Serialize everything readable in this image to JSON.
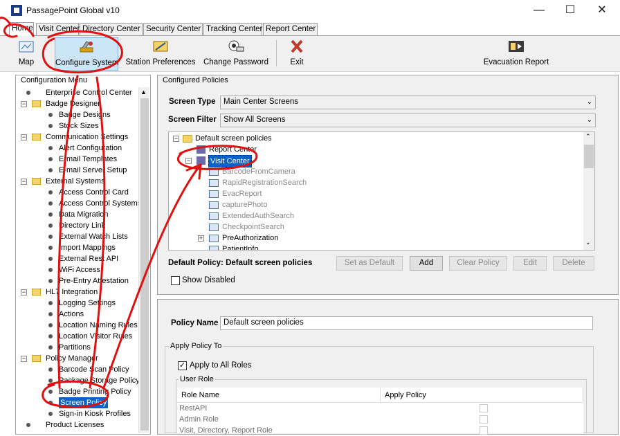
{
  "window": {
    "title": "PassagePoint Global v10",
    "minimize": "—",
    "maximize": "☐",
    "close": "✕"
  },
  "tabs": [
    "Home",
    "Visit Center",
    "Directory Center",
    "Security Center",
    "Tracking Center",
    "Report Center"
  ],
  "toolbar": {
    "map": "Map",
    "configure_system": "Configure System",
    "station_preferences": "Station Preferences",
    "change_password": "Change Password",
    "exit": "Exit",
    "evacuation_report": "Evacuation Report"
  },
  "config_menu": {
    "legend": "Configuration Menu",
    "items": [
      "Enterprise Control Center",
      "Badge Designer",
      "Badge Designs",
      "Stock Sizes",
      "Communication Settings",
      "Alert Configuration",
      "E-mail Templates",
      "E-mail Server Setup",
      "External Systems",
      "Access Control Card",
      "Access Control Systems",
      "Data Migration",
      "Directory Link",
      "External Watch Lists",
      "Import Mappings",
      "External Rest API",
      "WiFi Access",
      "Pre-Entry Attestation",
      "HL7 Integration",
      "Logging Settings",
      "Actions",
      "Location Naming Rules",
      "Location Visitor Rules",
      "Partitions",
      "Policy Manager",
      "Barcode Scan Policy",
      "Package Storage Policy",
      "Badge Printing Policy",
      "Screen Policy",
      "Sign-in Kiosk Profiles",
      "Product Licenses"
    ]
  },
  "configured_policies": {
    "legend": "Configured Policies",
    "screen_type_label": "Screen Type",
    "screen_type_value": "Main Center Screens",
    "screen_filter_label": "Screen Filter",
    "screen_filter_value": "Show All Screens",
    "tree": {
      "root": "Default screen policies",
      "report_center": "Report Center",
      "visit_center": "Visit Center",
      "children": [
        "BarcodeFromCamera",
        "RapidRegistrationSearch",
        "EvacReport",
        "capturePhoto",
        "ExtendedAuthSearch",
        "CheckpointSearch",
        "PreAuthorization",
        "PatientInfo"
      ]
    },
    "default_policy_label": "Default Policy: Default screen policies",
    "buttons": {
      "set_default": "Set as Default",
      "add": "Add",
      "clear": "Clear Policy",
      "edit": "Edit",
      "delete": "Delete"
    },
    "show_disabled": "Show Disabled"
  },
  "policy": {
    "name_label": "Policy Name",
    "name_value": "Default screen policies",
    "apply_legend": "Apply Policy To",
    "apply_all_roles": "Apply to All Roles",
    "user_role_legend": "User Role",
    "columns": [
      "Role Name",
      "Apply Policy"
    ],
    "rows": [
      "RestAPI",
      "Admin Role",
      "Visit, Directory, Report Role"
    ]
  }
}
